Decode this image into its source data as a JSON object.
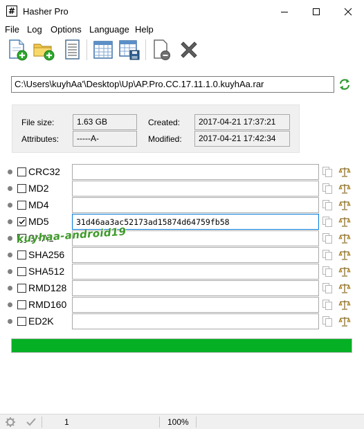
{
  "window": {
    "title": "Hasher Pro"
  },
  "menu": [
    "File",
    "Log",
    "Options",
    "Language",
    "Help"
  ],
  "toolbar": {
    "buttons": [
      "new-file-icon",
      "open-folder-icon",
      "document-icon",
      "table-icon",
      "save-table-icon",
      "clear-icon",
      "cancel-icon"
    ]
  },
  "file": {
    "path": "C:\\Users\\kuyhAa'\\Desktop\\Up\\AP.Pro.CC.17.11.1.0.kuyhAa.rar"
  },
  "info": {
    "file_size_label": "File size:",
    "file_size": "1.63 GB",
    "attributes_label": "Attributes:",
    "attributes": "-----A-",
    "created_label": "Created:",
    "created": "2017-04-21 17:37:21",
    "modified_label": "Modified:",
    "modified": "2017-04-21 17:42:34"
  },
  "hashes": [
    {
      "name": "CRC32",
      "checked": false,
      "value": ""
    },
    {
      "name": "MD2",
      "checked": false,
      "value": ""
    },
    {
      "name": "MD4",
      "checked": false,
      "value": ""
    },
    {
      "name": "MD5",
      "checked": true,
      "value": "31d46aa3ac52173ad15874d64759fb58"
    },
    {
      "name": "SHA1",
      "checked": false,
      "value": ""
    },
    {
      "name": "SHA256",
      "checked": false,
      "value": ""
    },
    {
      "name": "SHA512",
      "checked": false,
      "value": ""
    },
    {
      "name": "RMD128",
      "checked": false,
      "value": ""
    },
    {
      "name": "RMD160",
      "checked": false,
      "value": ""
    },
    {
      "name": "ED2K",
      "checked": false,
      "value": ""
    }
  ],
  "watermark": "kuyhaa-android19",
  "progress": {
    "fraction": 1.0,
    "color": "#06b025"
  },
  "status": {
    "count": "1",
    "zoom": "100%"
  }
}
